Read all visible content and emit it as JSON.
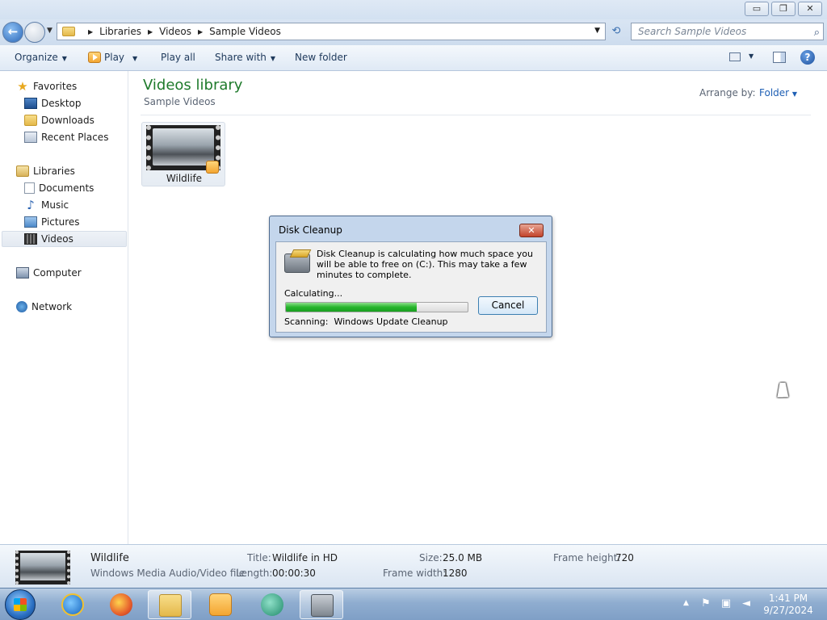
{
  "window": {
    "caption_buttons": {
      "minimize": "▭",
      "restore": "❐",
      "close": "✕"
    }
  },
  "address": {
    "back_glyph": "←",
    "breadcrumbs": [
      "Libraries",
      "Videos",
      "Sample Videos"
    ],
    "search_placeholder": "Search Sample Videos"
  },
  "commands": {
    "organize": "Organize",
    "play": "Play",
    "play_all": "Play all",
    "share_with": "Share with",
    "new_folder": "New folder",
    "help": "?"
  },
  "nav": {
    "favorites_label": "Favorites",
    "favorites": [
      "Desktop",
      "Downloads",
      "Recent Places"
    ],
    "libraries_label": "Libraries",
    "libraries": [
      "Documents",
      "Music",
      "Pictures",
      "Videos"
    ],
    "computer": "Computer",
    "network": "Network",
    "selected": "Videos"
  },
  "content": {
    "title": "Videos library",
    "subtitle": "Sample Videos",
    "arrange_label": "Arrange by:",
    "arrange_value": "Folder",
    "files": [
      {
        "name": "Wildlife"
      }
    ]
  },
  "dialog": {
    "title": "Disk Cleanup",
    "close_glyph": "✕",
    "message": "Disk Cleanup is calculating how much space you will be able to free on  (C:). This may take a few minutes to complete.",
    "status": "Calculating...",
    "progress": 0.72,
    "cancel": "Cancel",
    "scanning_label": "Scanning:",
    "scanning_item": "Windows Update Cleanup"
  },
  "details": {
    "name": "Wildlife",
    "type": "Windows Media Audio/Video file",
    "title_label": "Title:",
    "title_value": "Wildlife in HD",
    "length_label": "Length:",
    "length_value": "00:00:30",
    "size_label": "Size:",
    "size_value": "25.0 MB",
    "frame_width_label": "Frame width:",
    "frame_width_value": "1280",
    "frame_height_label": "Frame height:",
    "frame_height_value": "720"
  },
  "taskbar": {
    "apps": [
      "internet-explorer",
      "firefox",
      "windows-explorer",
      "windows-media-player",
      "windows-media-center",
      "disk-cleanup"
    ],
    "active": [
      "windows-explorer",
      "disk-cleanup"
    ],
    "time": "1:41 PM",
    "date": "9/27/2024"
  },
  "colors": {
    "library_title": "#1e7a2b",
    "link_blue": "#1e5fb4",
    "progress_green": "#26b52b",
    "close_red": "#c2432a"
  }
}
